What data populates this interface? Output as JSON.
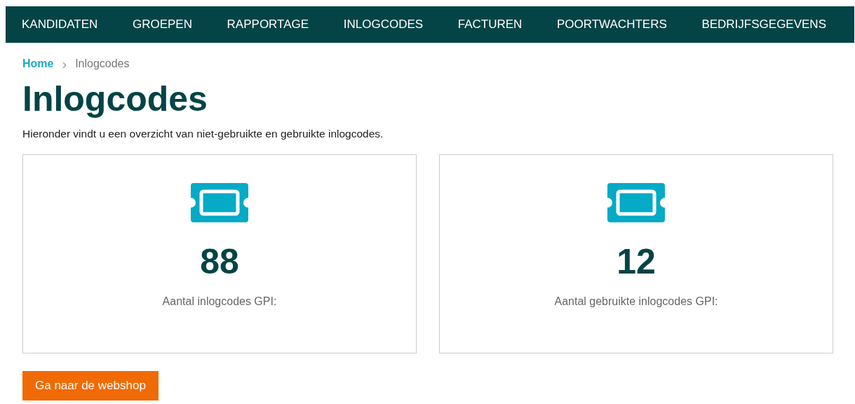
{
  "nav": {
    "items": [
      {
        "label": "KANDIDATEN"
      },
      {
        "label": "GROEPEN"
      },
      {
        "label": "RAPPORTAGE"
      },
      {
        "label": "INLOGCODES"
      },
      {
        "label": "FACTUREN"
      },
      {
        "label": "POORTWACHTERS"
      },
      {
        "label": "BEDRIJFSGEGEVENS"
      }
    ]
  },
  "breadcrumb": {
    "home": "Home",
    "separator": "›",
    "current": "Inlogcodes"
  },
  "title": "Inlogcodes",
  "intro": "Hieronder vindt u een overzicht van niet-gebruikte en gebruikte inlogcodes.",
  "cards": [
    {
      "count": "88",
      "label": "Aantal inlogcodes GPI:"
    },
    {
      "count": "12",
      "label": "Aantal gebruikte inlogcodes GPI:"
    }
  ],
  "button": "Ga naar de webshop"
}
